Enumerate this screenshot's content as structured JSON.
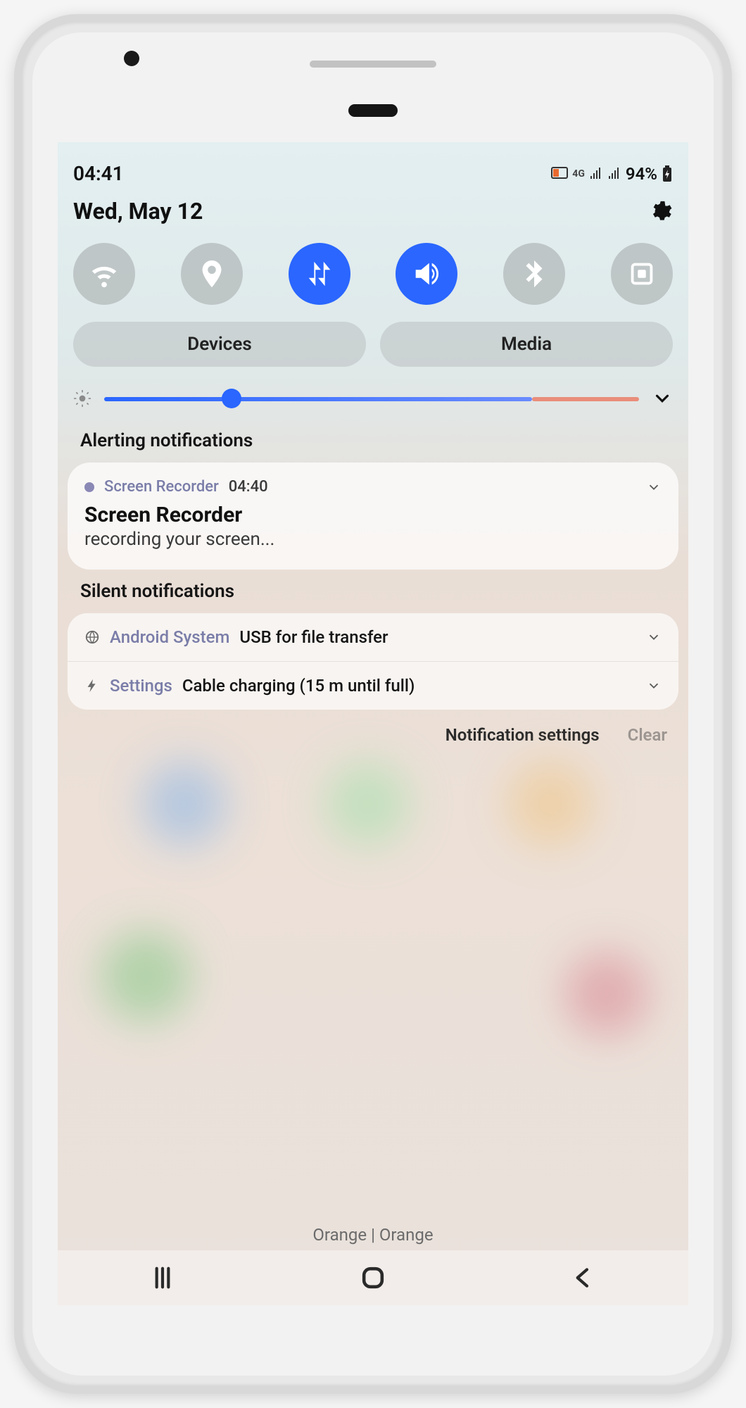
{
  "status": {
    "time": "04:41",
    "network_label": "4G",
    "battery_pct": "94%"
  },
  "header": {
    "date": "Wed, May 12"
  },
  "quick_toggles": [
    {
      "name": "wifi",
      "active": false
    },
    {
      "name": "location",
      "active": false
    },
    {
      "name": "mobile-data",
      "active": true
    },
    {
      "name": "sound",
      "active": true
    },
    {
      "name": "bluetooth",
      "active": false
    },
    {
      "name": "rotation-lock",
      "active": false
    }
  ],
  "pills": {
    "devices": "Devices",
    "media": "Media"
  },
  "brightness": {
    "value_pct": 22
  },
  "alerting": {
    "label": "Alerting notifications",
    "items": [
      {
        "app": "Screen Recorder",
        "time": "04:40",
        "title": "Screen Recorder",
        "body": "recording your screen..."
      }
    ]
  },
  "silent": {
    "label": "Silent notifications",
    "items": [
      {
        "icon": "globe",
        "app": "Android System",
        "msg": "USB for file transfer"
      },
      {
        "icon": "bolt",
        "app": "Settings",
        "msg": "Cable charging (15 m until full)"
      }
    ]
  },
  "footer": {
    "settings": "Notification settings",
    "clear": "Clear"
  },
  "carrier": "Orange | Orange"
}
